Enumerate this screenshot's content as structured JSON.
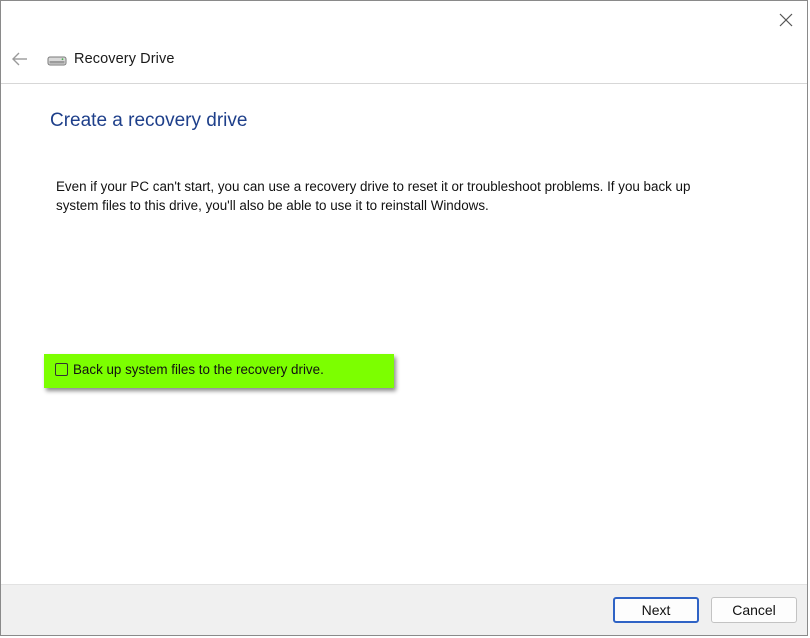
{
  "window": {
    "title": "Recovery Drive"
  },
  "icons": {
    "back": "back-arrow-icon",
    "drive": "drive-icon",
    "close": "close-icon"
  },
  "content": {
    "heading": "Create a recovery drive",
    "description": "Even if your PC can't start, you can use a recovery drive to reset it or troubleshoot problems. If you back up system files to this drive, you'll also be able to use it to reinstall Windows.",
    "checkbox": {
      "label": "Back up system files to the recovery drive.",
      "checked": false,
      "highlight_color": "#7cff00"
    }
  },
  "footer": {
    "next_label": "Next",
    "cancel_label": "Cancel"
  },
  "colors": {
    "heading": "#1e3f8a",
    "accent_border": "#2f63c5"
  }
}
